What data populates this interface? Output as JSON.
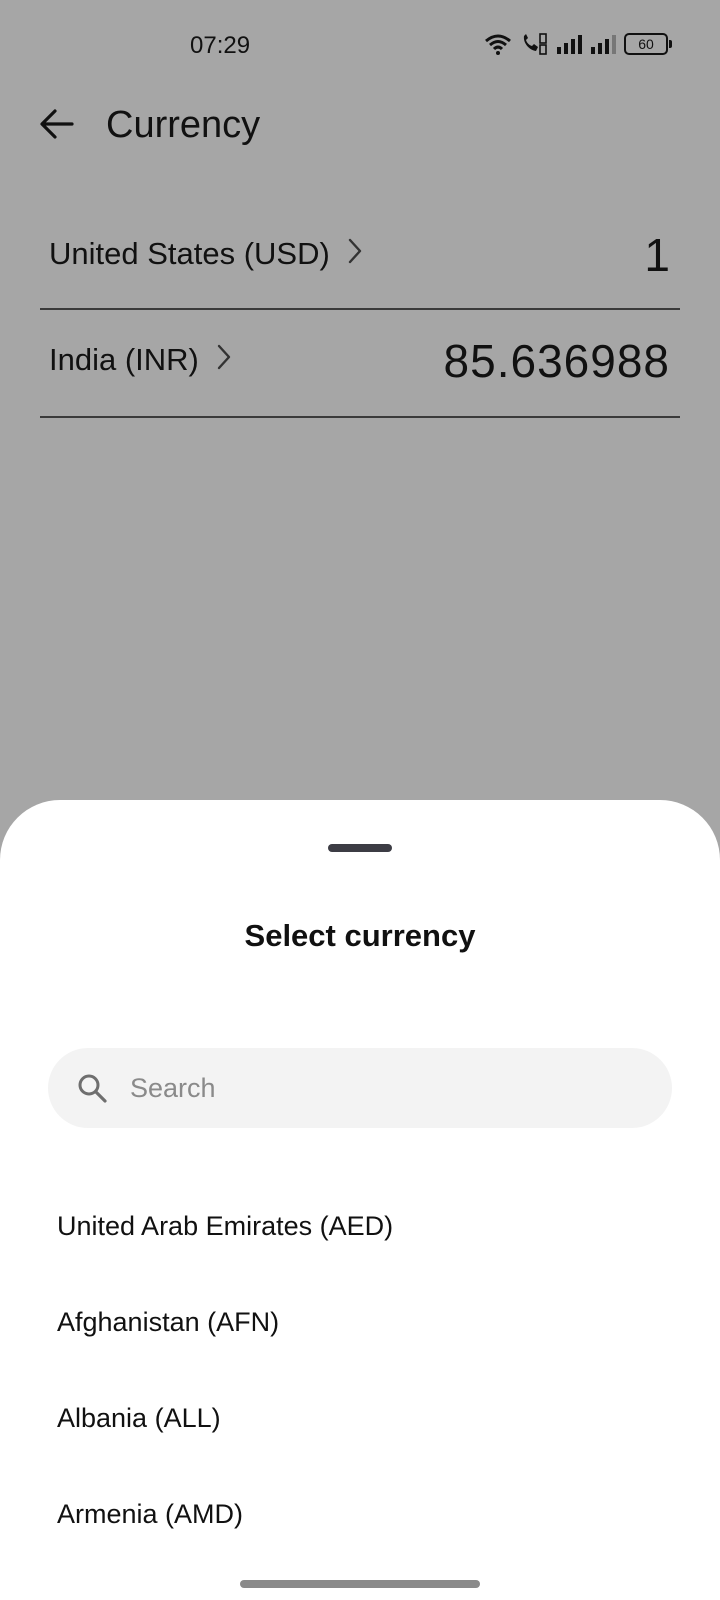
{
  "status_bar": {
    "time": "07:29",
    "battery": "60",
    "icons": [
      "wifi-icon",
      "volte-call-icon",
      "signal-icon",
      "signal-icon",
      "battery-icon"
    ]
  },
  "app_bar": {
    "back_icon": "arrow-left-icon",
    "title": "Currency"
  },
  "converter": {
    "rows": [
      {
        "country": "United States (USD)",
        "value": "1",
        "icon": "chevron-right-icon"
      },
      {
        "country": "India (INR)",
        "value": "85.636988",
        "icon": "chevron-right-icon"
      }
    ]
  },
  "sheet": {
    "title": "Select currency",
    "search": {
      "placeholder": "Search",
      "value": "",
      "icon": "search-icon"
    },
    "items": [
      {
        "label": "United Arab Emirates (AED)"
      },
      {
        "label": "Afghanistan (AFN)"
      },
      {
        "label": "Albania (ALL)"
      },
      {
        "label": "Armenia (AMD)"
      }
    ]
  },
  "colors": {
    "scrim": "#a6a6a6",
    "sheet_bg": "#ffffff",
    "search_bg": "#f3f3f3",
    "divider": "#3a3a3a",
    "text": "#111111",
    "placeholder": "#8a8a8a"
  }
}
